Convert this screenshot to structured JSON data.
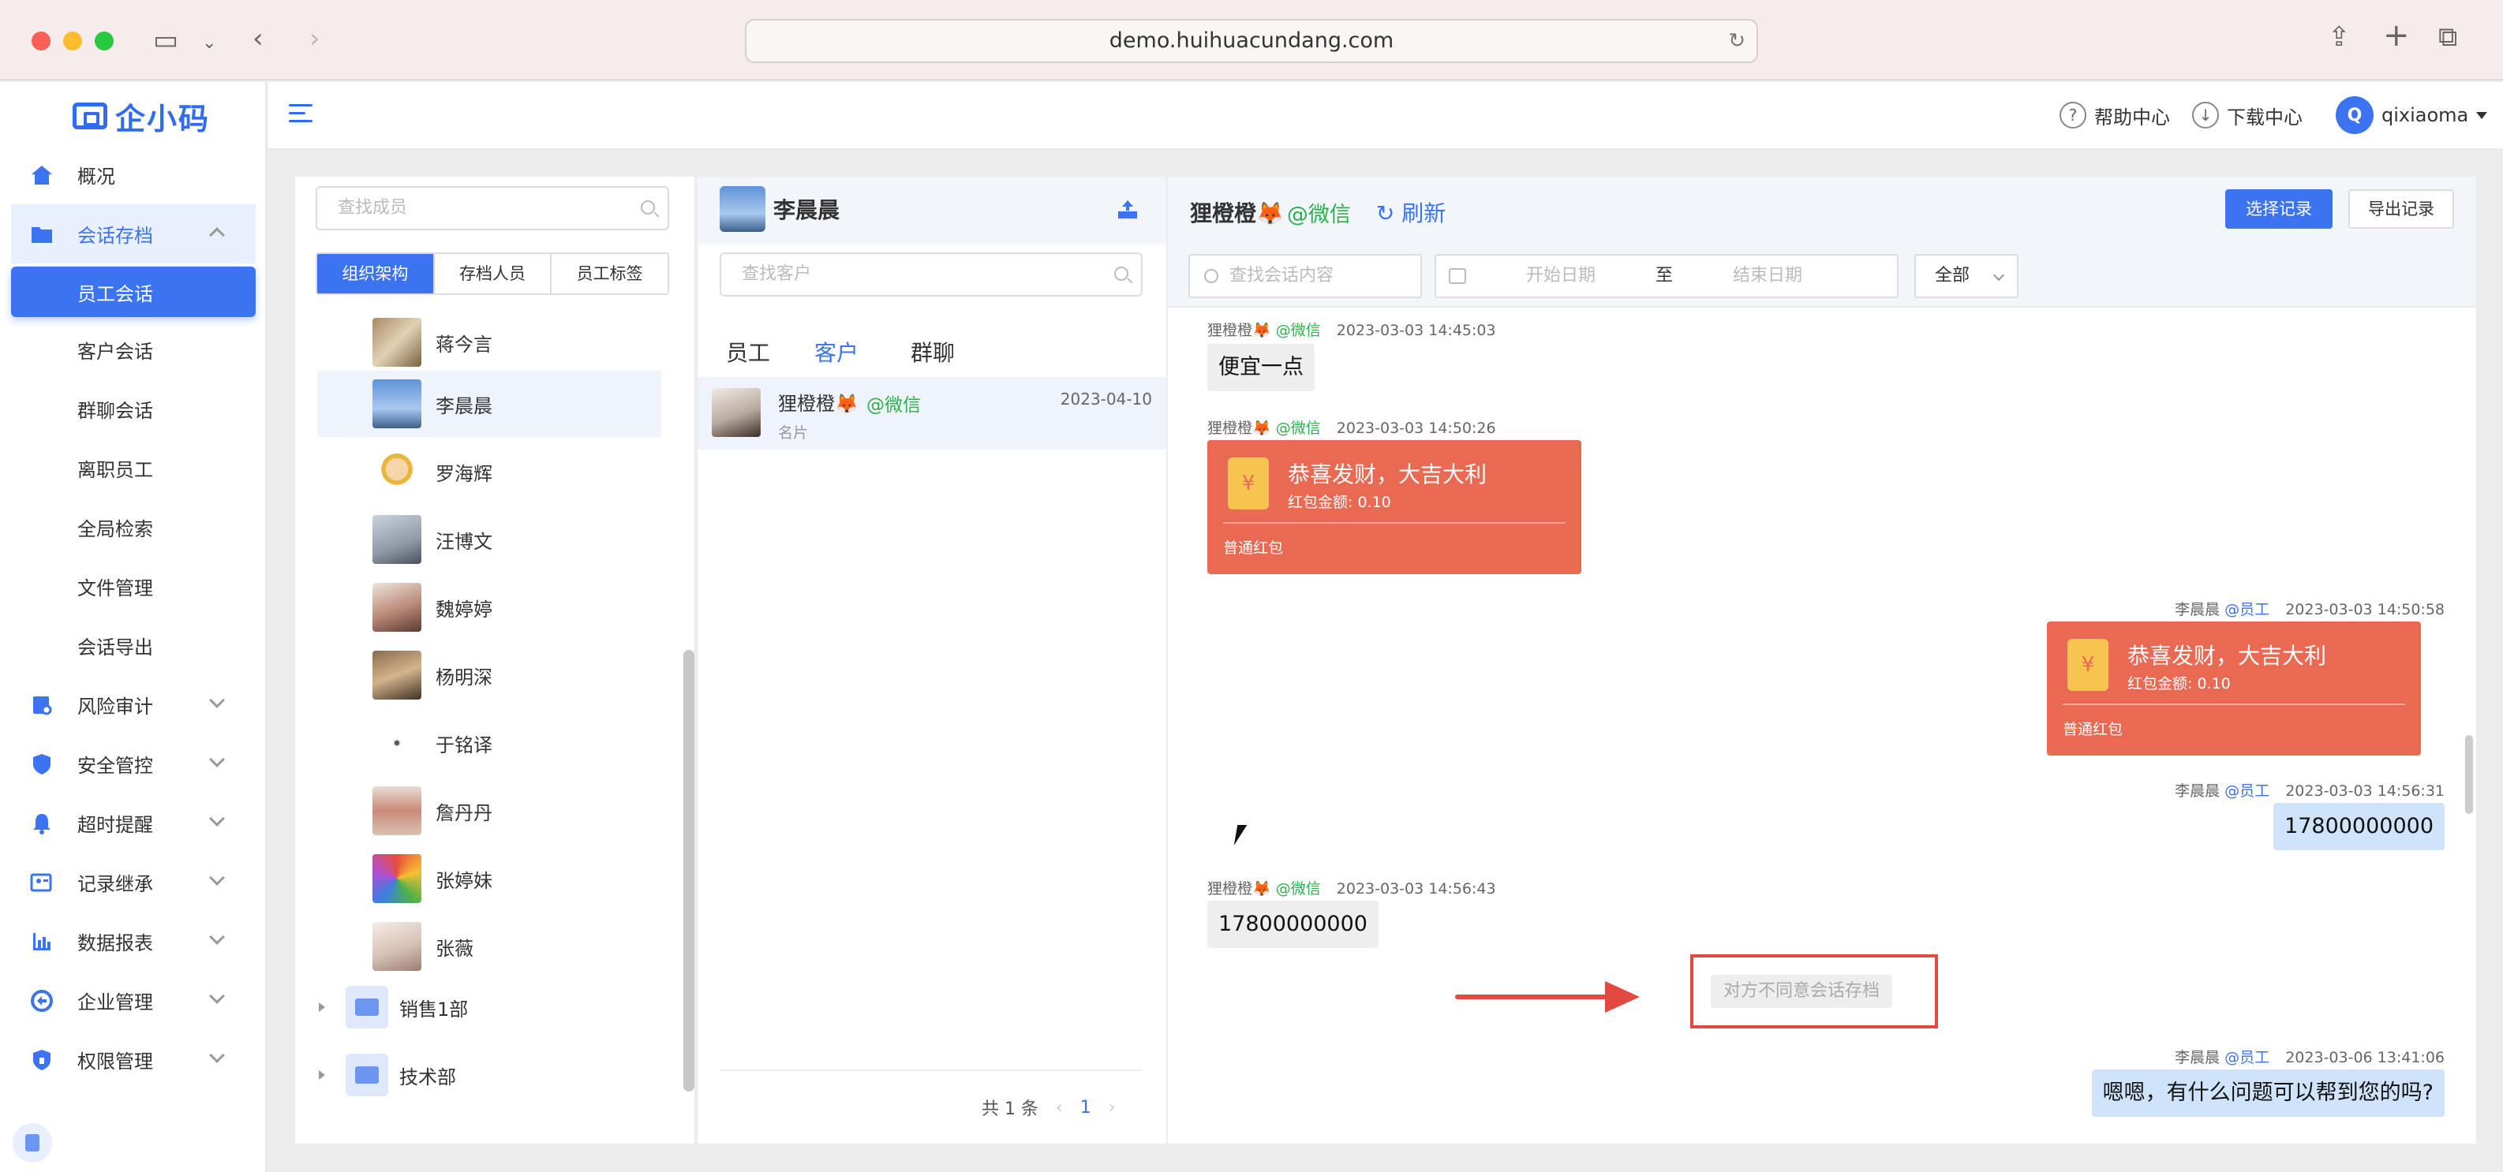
{
  "browser": {
    "url": "demo.huihuacundang.com"
  },
  "app": {
    "logo_text": "企小码",
    "brand_color": "#2f6cf2"
  },
  "sidebar": {
    "items": [
      {
        "label": "概况",
        "icon": "home-icon"
      },
      {
        "label": "会话存档",
        "icon": "archive-icon"
      },
      {
        "label": "员工会话"
      },
      {
        "label": "客户会话"
      },
      {
        "label": "群聊会话"
      },
      {
        "label": "离职员工"
      },
      {
        "label": "全局检索"
      },
      {
        "label": "文件管理"
      },
      {
        "label": "会话导出"
      },
      {
        "label": "风险审计",
        "icon": "audit-icon"
      },
      {
        "label": "安全管控",
        "icon": "shield-icon"
      },
      {
        "label": "超时提醒",
        "icon": "bell-icon"
      },
      {
        "label": "记录继承",
        "icon": "inherit-icon"
      },
      {
        "label": "数据报表",
        "icon": "chart-icon"
      },
      {
        "label": "企业管理",
        "icon": "enterprise-icon"
      },
      {
        "label": "权限管理",
        "icon": "lock-shield-icon"
      }
    ]
  },
  "topbar": {
    "help": "帮助中心",
    "download": "下载中心",
    "avatar_letter": "Q",
    "user": "qixiaoma"
  },
  "members_panel": {
    "search_placeholder": "查找成员",
    "tabs": [
      "组织架构",
      "存档人员",
      "员工标签"
    ],
    "members": [
      "蒋今言",
      "李晨晨",
      "罗海辉",
      "汪博文",
      "魏婷婷",
      "杨明深",
      "于铭译",
      "詹丹丹",
      "张婷妹",
      "张薇"
    ],
    "depts": [
      "销售1部",
      "技术部"
    ]
  },
  "customer_panel": {
    "staff_name": "李晨晨",
    "search_placeholder": "查找客户",
    "tabs": [
      "员工",
      "客户",
      "群聊"
    ],
    "item": {
      "name": "狸橙橙🦊",
      "source": "@微信",
      "date": "2023-04-10",
      "preview": "名片"
    },
    "pager": {
      "total": "共 1 条",
      "prev": "‹",
      "page": "1",
      "next": "›"
    }
  },
  "chat_panel": {
    "contact": "狸橙橙🦊",
    "source": "@微信",
    "refresh": "刷新",
    "select_btn": "选择记录",
    "export_btn": "导出记录",
    "search_placeholder": "查找会话内容",
    "start_date": "开始日期",
    "to": "至",
    "end_date": "结束日期",
    "filter": "全部",
    "messages": [
      {
        "sender": "狸橙橙🦊",
        "tag": "@微信",
        "time": "2023-03-03 14:45:03",
        "text": "便宜一点"
      },
      {
        "sender": "狸橙橙🦊",
        "tag": "@微信",
        "time": "2023-03-03 14:50:26",
        "rp_title": "恭喜发财，大吉大利",
        "rp_amount": "红包金额: 0.10",
        "rp_kind": "普通红包"
      },
      {
        "sender": "李晨晨",
        "tag": "@员工",
        "time": "2023-03-03 14:50:58",
        "rp_title": "恭喜发财，大吉大利",
        "rp_amount": "红包金额: 0.10",
        "rp_kind": "普通红包"
      },
      {
        "sender": "李晨晨",
        "tag": "@员工",
        "time": "2023-03-03 14:56:31",
        "text": "17800000000"
      },
      {
        "sender": "狸橙橙🦊",
        "tag": "@微信",
        "time": "2023-03-03 14:56:43",
        "text": "17800000000"
      },
      {
        "sender": "李晨晨",
        "tag": "@员工",
        "time": "2023-03-06 13:41:06",
        "text": "嗯嗯，有什么问题可以帮到您的吗?"
      }
    ],
    "system_notice": "对方不同意会话存档",
    "envelope_glyph": "¥",
    "colors": {
      "redpacket": "#e96953",
      "wechat": "#2cb14c",
      "staff": "#3b73f0",
      "highlight": "#e34a3f"
    }
  }
}
